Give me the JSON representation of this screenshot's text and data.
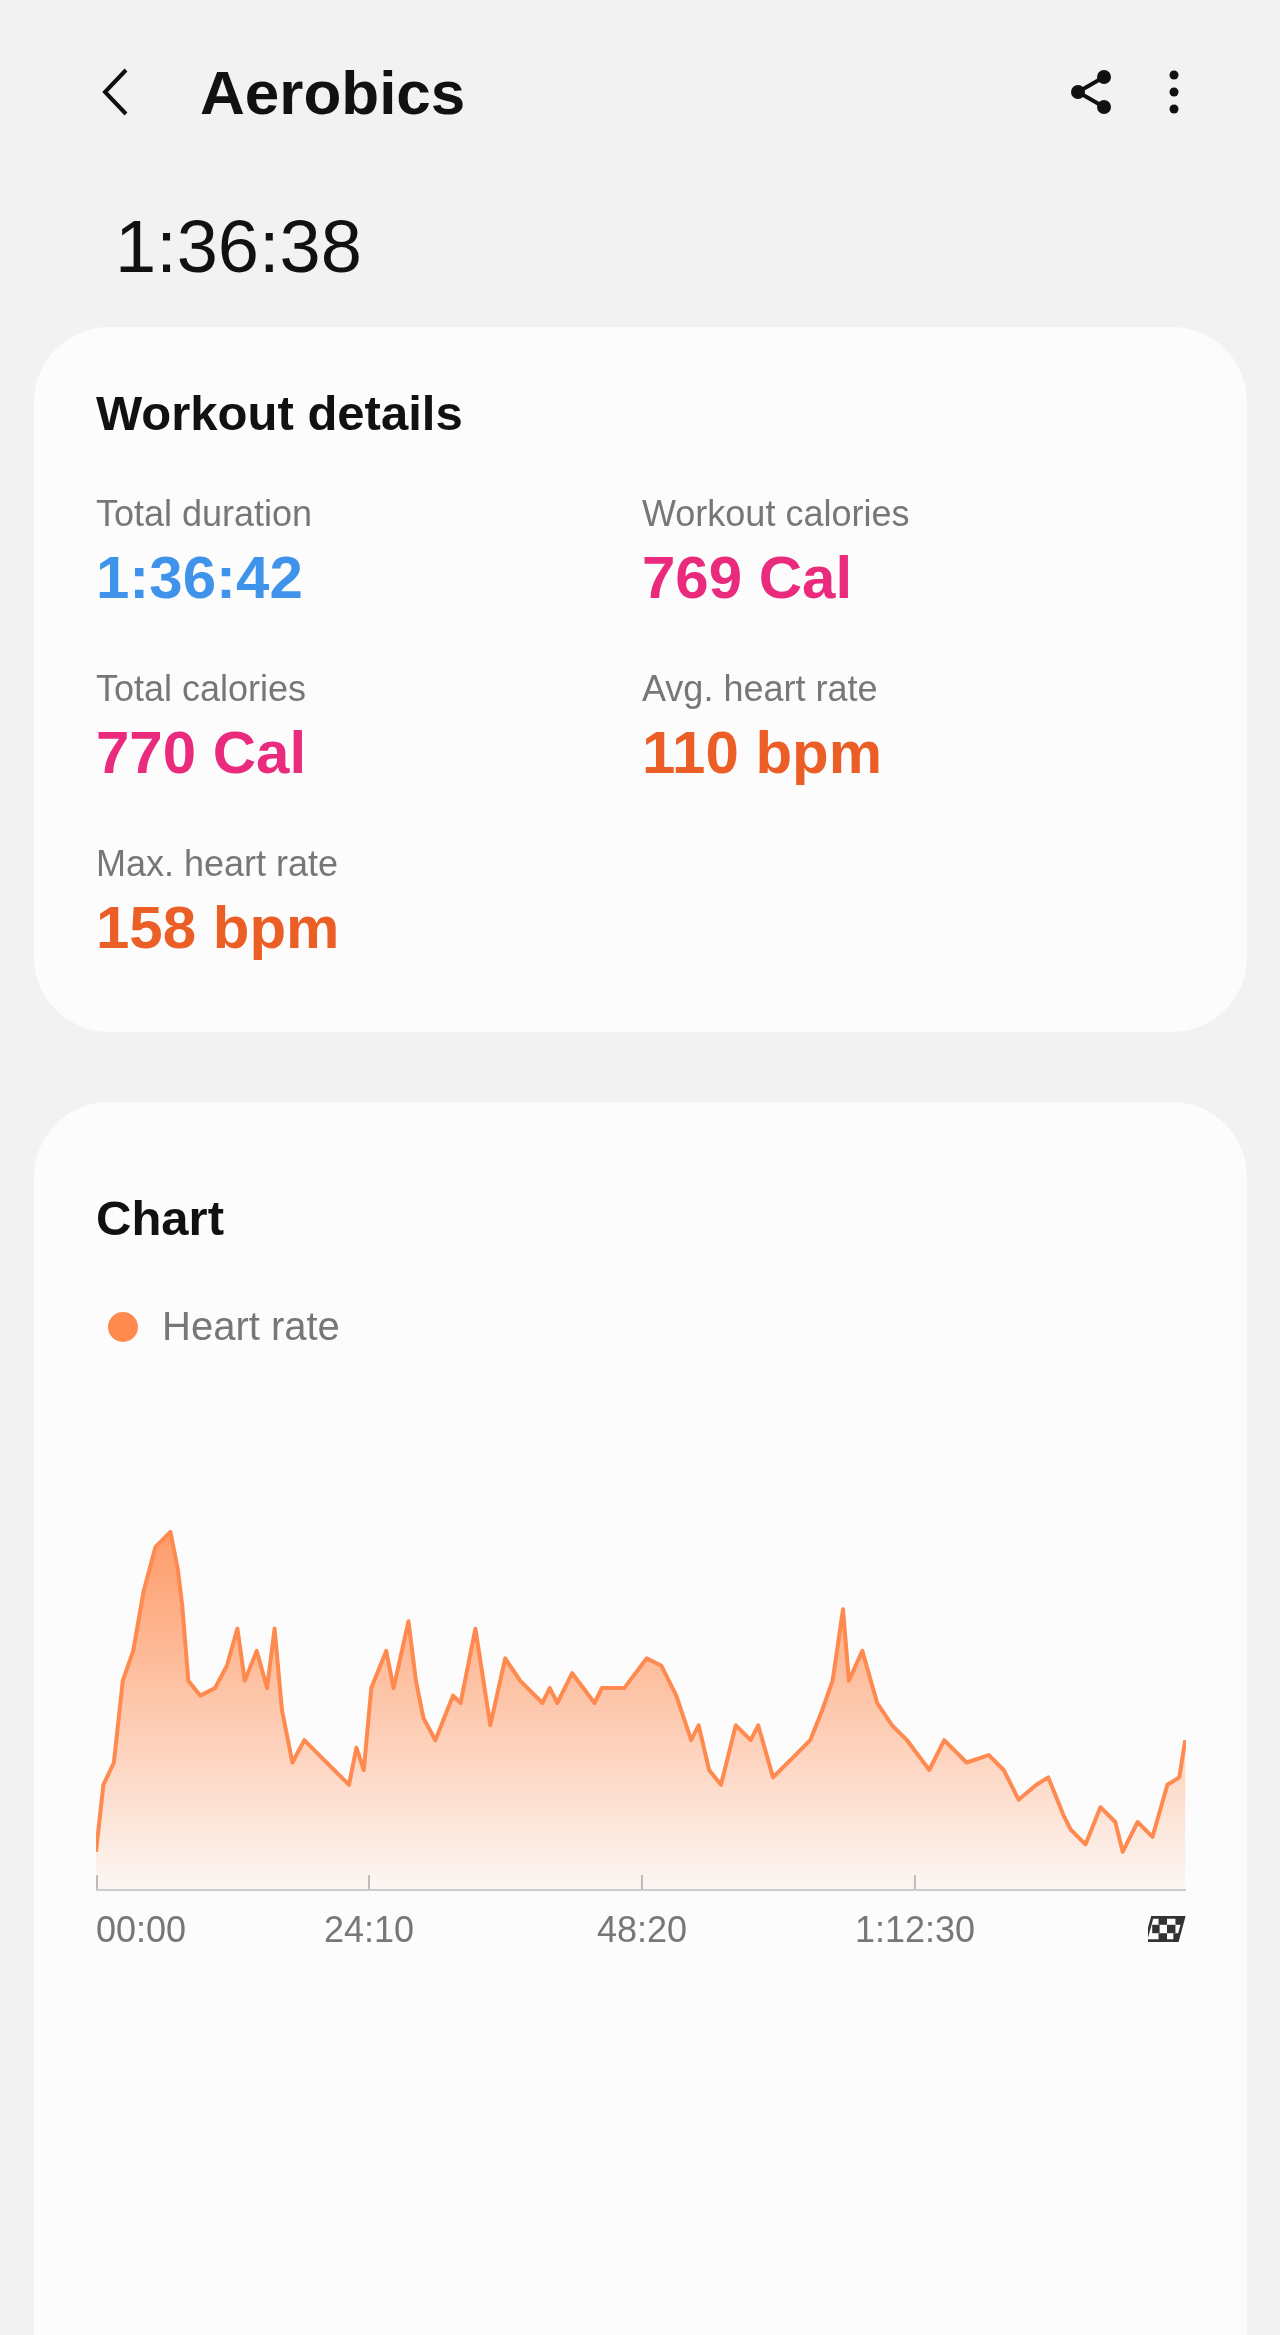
{
  "header": {
    "title": "Aerobics"
  },
  "time": "1:36:38",
  "workout_details": {
    "title": "Workout details",
    "stats": [
      {
        "label": "Total duration",
        "value": "1:36:42",
        "color": "#3f93ea"
      },
      {
        "label": "Workout calories",
        "value": "769 Cal",
        "color": "#ea2a7c"
      },
      {
        "label": "Total calories",
        "value": "770 Cal",
        "color": "#ea2a7c"
      },
      {
        "label": "Avg. heart rate",
        "value": "110 bpm",
        "color": "#eb5f27"
      },
      {
        "label": "Max. heart rate",
        "value": "158 bpm",
        "color": "#eb5f27"
      }
    ]
  },
  "chart": {
    "title": "Chart",
    "legend": [
      {
        "label": "Heart rate",
        "color": "#ff8a4f"
      }
    ],
    "x_labels": [
      "00:00",
      "24:10",
      "48:20",
      "1:12:30"
    ]
  }
}
